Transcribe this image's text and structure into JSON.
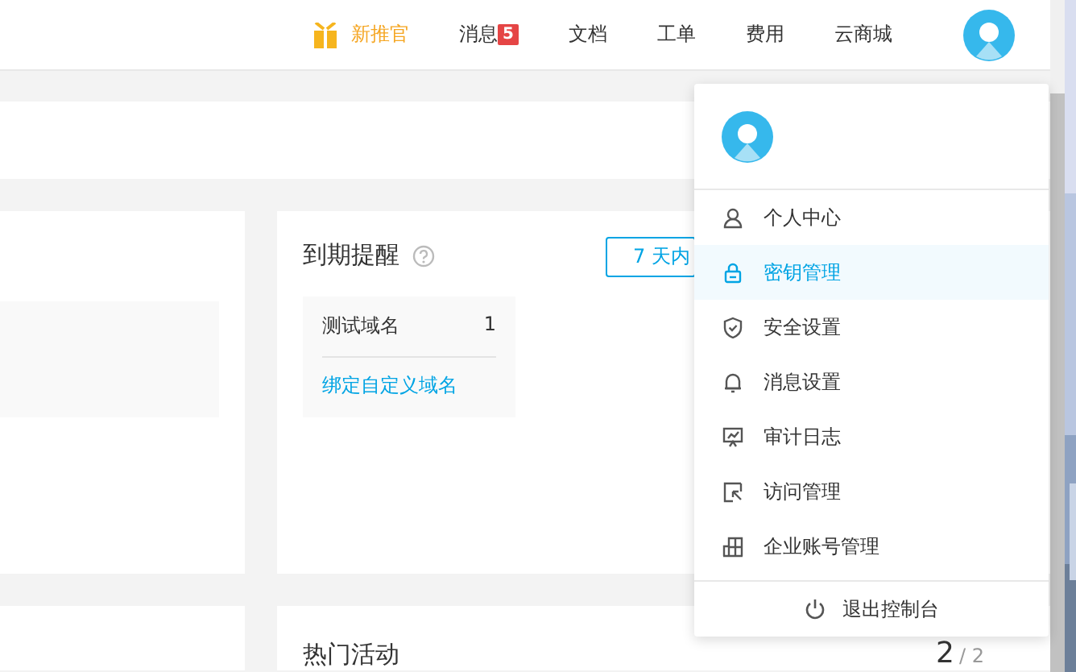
{
  "nav": {
    "items": [
      {
        "label": "新推官",
        "kind": "promo"
      },
      {
        "label": "消息",
        "kind": "badge",
        "badge": "5"
      },
      {
        "label": "文档",
        "kind": "plain"
      },
      {
        "label": "工单",
        "kind": "plain"
      },
      {
        "label": "费用",
        "kind": "plain"
      },
      {
        "label": "云商城",
        "kind": "plain"
      }
    ]
  },
  "expiry": {
    "title": "到期提醒",
    "filter": "7 天内",
    "domain": {
      "name": "测试域名",
      "count": "1"
    },
    "link": "绑定自定义域名"
  },
  "activities": {
    "title": "热门活动",
    "page": "2",
    "total": "/ 2"
  },
  "menu": {
    "items": [
      {
        "label": "个人中心",
        "kind": "user",
        "selected": false
      },
      {
        "label": "密钥管理",
        "kind": "lock",
        "selected": true
      },
      {
        "label": "安全设置",
        "kind": "shield",
        "selected": false
      },
      {
        "label": "消息设置",
        "kind": "bell",
        "selected": false
      },
      {
        "label": "审计日志",
        "kind": "monitor",
        "selected": false
      },
      {
        "label": "访问管理",
        "kind": "access",
        "selected": false
      },
      {
        "label": "企业账号管理",
        "kind": "building",
        "selected": false
      }
    ],
    "logout": "退出控制台"
  }
}
